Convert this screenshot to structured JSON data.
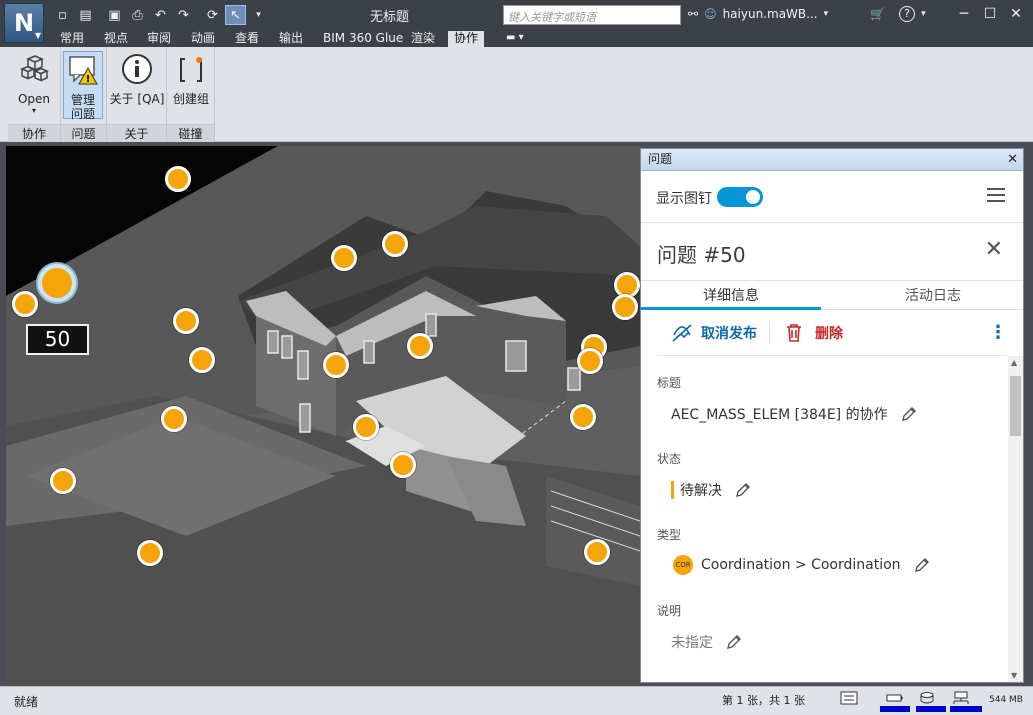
{
  "app": {
    "logo_letter": "N",
    "window_title": "无标题",
    "search_placeholder": "键入关键字或短语",
    "user": "haiyun.maWB...",
    "colors": {
      "accent": "#0696d7",
      "pin": "#f5a50a",
      "delete": "#c62828",
      "ribbon_bg": "#dfe3e8",
      "titlebar_bg": "#3c4148"
    }
  },
  "menu": {
    "tabs": [
      "常用",
      "视点",
      "审阅",
      "动画",
      "查看",
      "输出",
      "BIM 360 Glue",
      "渲染",
      "协作"
    ],
    "active_tab": "协作"
  },
  "ribbon": {
    "groups": [
      {
        "label": "协作",
        "buttons": [
          {
            "label": "Open",
            "icon": "cubes-icon",
            "dropdown": "▾"
          }
        ]
      },
      {
        "label": "问题",
        "buttons": [
          {
            "label": "管理\n问题",
            "icon": "issue-warning-icon",
            "active": true
          }
        ]
      },
      {
        "label": "关于",
        "buttons": [
          {
            "label": "关于 [QA]",
            "icon": "info-icon"
          }
        ]
      },
      {
        "label": "碰撞",
        "buttons": [
          {
            "label": "创建组",
            "icon": "bracket-create-icon"
          }
        ]
      }
    ]
  },
  "viewport": {
    "selected_issue_tag": "50"
  },
  "panel": {
    "header": "问题",
    "show_pins_label": "显示图钉",
    "show_pins_on": true,
    "issue_title": "问题 #50",
    "tabs": [
      "详细信息",
      "活动日志"
    ],
    "active_tab": "详细信息",
    "actions": {
      "unpublish": "取消发布",
      "delete": "删除"
    },
    "fields": [
      {
        "label": "标题",
        "value": "AEC_MASS_ELEM [384E] 的协作"
      },
      {
        "label": "状态",
        "value": "待解决"
      },
      {
        "label": "类型",
        "value": "Coordination > Coordination",
        "badge": "COR"
      },
      {
        "label": "说明",
        "value": "未指定"
      }
    ]
  },
  "statusbar": {
    "ready": "就绪",
    "pages": "第 1 张，共 1 张",
    "memory": "544 MB"
  }
}
